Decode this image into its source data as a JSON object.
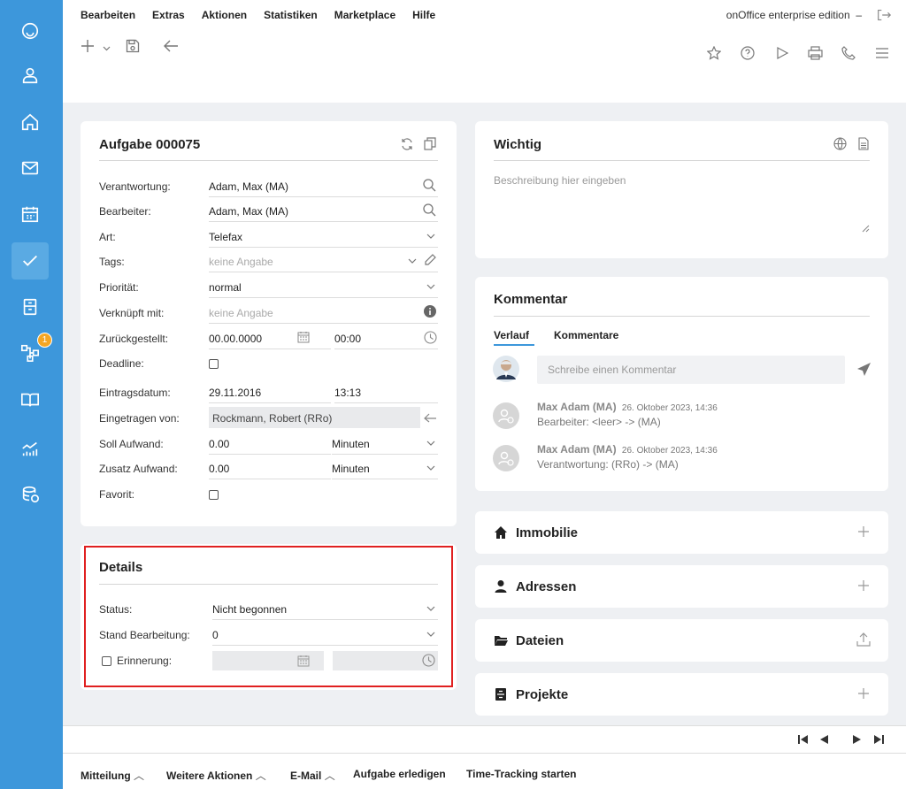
{
  "menu": [
    "Bearbeiten",
    "Extras",
    "Aktionen",
    "Statistiken",
    "Marketplace",
    "Hilfe"
  ],
  "edition": "onOffice enterprise edition",
  "edition_sep": "–",
  "sidebar": {
    "badge": "1"
  },
  "task": {
    "title": "Aufgabe 000075",
    "fields": {
      "verantwortung": {
        "label": "Verantwortung:",
        "value": "Adam, Max (MA)"
      },
      "bearbeiter": {
        "label": "Bearbeiter:",
        "value": "Adam, Max (MA)"
      },
      "art": {
        "label": "Art:",
        "value": "Telefax"
      },
      "tags": {
        "label": "Tags:",
        "value": "keine Angabe"
      },
      "prioritaet": {
        "label": "Priorität:",
        "value": "normal"
      },
      "verknuepft": {
        "label": "Verknüpft mit:",
        "value": "keine Angabe"
      },
      "zurueckgestellt": {
        "label": "Zurückgestellt:",
        "date": "00.00.0000",
        "time": "00:00"
      },
      "deadline": {
        "label": "Deadline:"
      },
      "eintragsdatum": {
        "label": "Eintragsdatum:",
        "date": "29.11.2016",
        "time": "13:13"
      },
      "eingetragen_von": {
        "label": "Eingetragen von:",
        "value": "Rockmann, Robert (RRo)"
      },
      "soll_aufwand": {
        "label": "Soll Aufwand:",
        "value": "0.00",
        "unit": "Minuten"
      },
      "zusatz_aufwand": {
        "label": "Zusatz Aufwand:",
        "value": "0.00",
        "unit": "Minuten"
      },
      "favorit": {
        "label": "Favorit:"
      }
    }
  },
  "details": {
    "title": "Details",
    "status": {
      "label": "Status:",
      "value": "Nicht begonnen"
    },
    "stand": {
      "label": "Stand Bearbeitung:",
      "value": "0"
    },
    "erinnerung": {
      "label": "Erinnerung:"
    }
  },
  "wichtig": {
    "title": "Wichtig",
    "placeholder": "Beschreibung hier eingeben"
  },
  "kommentar": {
    "title": "Kommentar",
    "tabs": [
      "Verlauf",
      "Kommentare"
    ],
    "input_placeholder": "Schreibe einen Kommentar",
    "entries": [
      {
        "author": "Max Adam (MA)",
        "date": "26. Oktober 2023, 14:36",
        "text": "Bearbeiter: <leer> -> (MA)"
      },
      {
        "author": "Max Adam (MA)",
        "date": "26. Oktober 2023, 14:36",
        "text": "Verantwortung: (RRo) -> (MA)"
      }
    ]
  },
  "accordion": [
    {
      "label": "Immobilie",
      "icon": "home-icon",
      "action": "plus-icon"
    },
    {
      "label": "Adressen",
      "icon": "user-icon",
      "action": "plus-icon"
    },
    {
      "label": "Dateien",
      "icon": "folder-icon",
      "action": "upload-icon"
    },
    {
      "label": "Projekte",
      "icon": "project-icon",
      "action": "plus-icon"
    }
  ],
  "footer": {
    "mitteilung": "Mitteilung",
    "weitere": "Weitere Aktionen",
    "email": "E-Mail",
    "erledigen": "Aufgabe erledigen",
    "tracking": "Time-Tracking starten"
  },
  "colors": {
    "sidebar": "#3d97db",
    "accent": "#3d97db",
    "highlight": "#e02020",
    "badge": "#f5a623"
  }
}
